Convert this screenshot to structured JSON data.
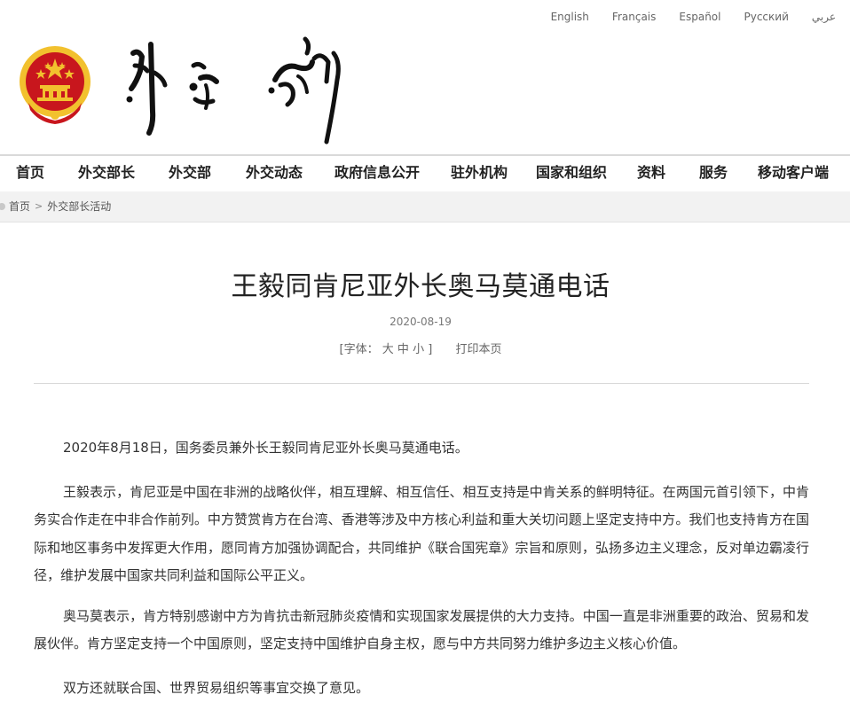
{
  "languages": [
    "English",
    "Français",
    "Español",
    "Русский",
    "عربي"
  ],
  "nav": [
    "首页",
    "外交部长",
    "外交部",
    "外交动态",
    "政府信息公开",
    "驻外机构",
    "国家和组织",
    "资料",
    "服务",
    "移动客户端"
  ],
  "breadcrumb": {
    "home": "首页",
    "sep": ">",
    "section": "外交部长活动"
  },
  "article": {
    "title": "王毅同肯尼亚外长奥马莫通电话",
    "date": "2020-08-19",
    "font_size_label_open": "[字体：",
    "font_large": "大",
    "font_medium": "中",
    "font_small": "小",
    "font_size_label_close": "]",
    "print": "打印本页",
    "paragraphs": [
      "2020年8月18日，国务委员兼外长王毅同肯尼亚外长奥马莫通电话。",
      "王毅表示，肯尼亚是中国在非洲的战略伙伴，相互理解、相互信任、相互支持是中肯关系的鲜明特征。在两国元首引领下，中肯务实合作走在中非合作前列。中方赞赏肯方在台湾、香港等涉及中方核心利益和重大关切问题上坚定支持中方。我们也支持肯方在国际和地区事务中发挥更大作用，愿同肯方加强协调配合，共同维护《联合国宪章》宗旨和原则，弘扬多边主义理念，反对单边霸凌行径，维护发展中国家共同利益和国际公平正义。",
      "奥马莫表示，肯方特别感谢中方为肯抗击新冠肺炎疫情和实现国家发展提供的大力支持。中国一直是非洲重要的政治、贸易和发展伙伴。肯方坚定支持一个中国原则，坚定支持中国维护自身主权，愿与中方共同努力维护多边主义核心价值。",
      "双方还就联合国、世界贸易组织等事宜交换了意见。"
    ]
  },
  "colors": {
    "emblem_red": "#c8161d",
    "emblem_gold": "#f2c12e",
    "calligraphy": "#111111",
    "nav_text": "#222222"
  }
}
